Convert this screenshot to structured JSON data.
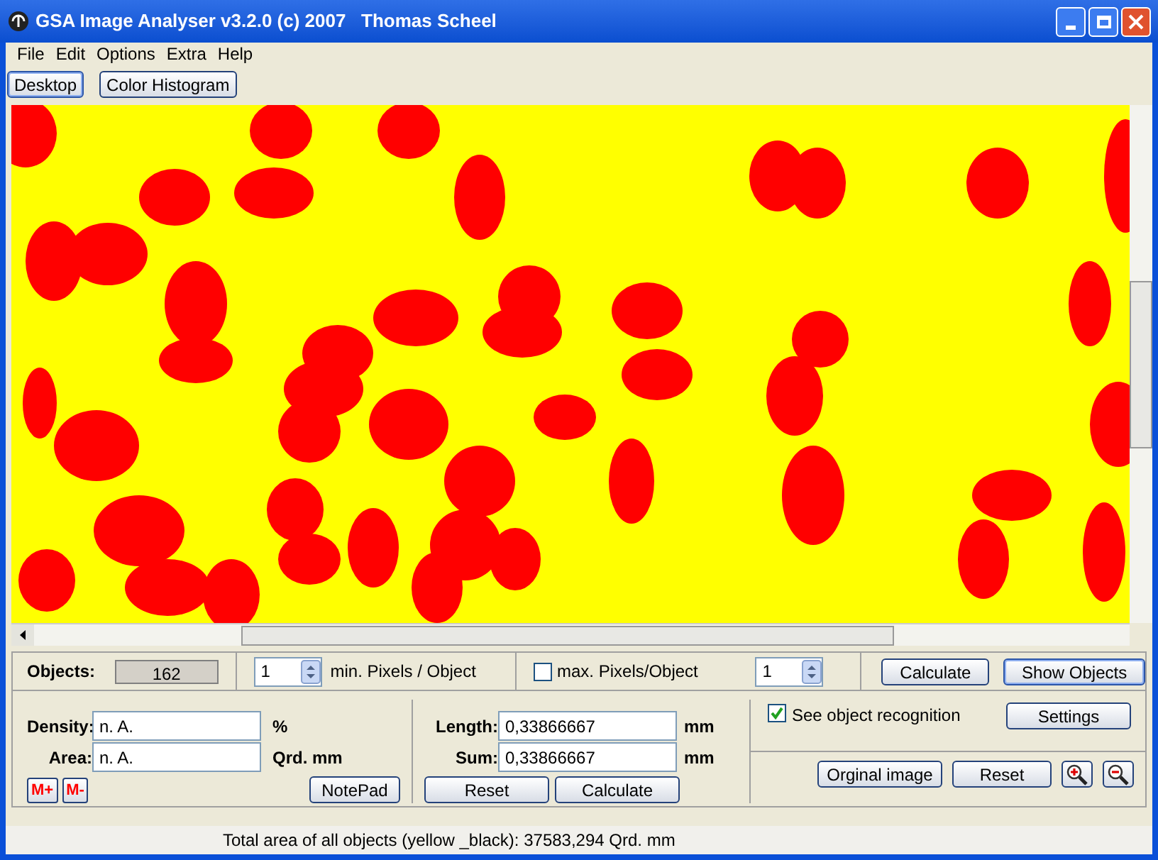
{
  "window": {
    "title": "GSA Image Analyser v3.2.0 (c) 2007   Thomas Scheel"
  },
  "menu": [
    "File",
    "Edit",
    "Options",
    "Extra",
    "Help"
  ],
  "toolbar": [
    {
      "label": "Desktop",
      "selected": true
    },
    {
      "label": "Color Histogram",
      "selected": false
    }
  ],
  "objects": {
    "label": "Objects:",
    "count": "162",
    "min_value": "1",
    "min_label": "min. Pixels / Object",
    "max_checked": false,
    "max_label": "max. Pixels/Object",
    "max_value": "1",
    "calculate": "Calculate",
    "show_objects": "Show Objects"
  },
  "density": {
    "label": "Density:",
    "value": "n. A.",
    "unit": "%"
  },
  "area": {
    "label": "Area:",
    "value": "n. A.",
    "unit": "Qrd. mm"
  },
  "memory": [
    "M+",
    "M-"
  ],
  "notepad": "NotePad",
  "length": {
    "label": "Length:",
    "value": "0,33866667",
    "unit": "mm"
  },
  "sum": {
    "label": "Sum:",
    "value": "0,33866667",
    "unit": "mm"
  },
  "measure_buttons": [
    "Reset",
    "Calculate"
  ],
  "recognition": {
    "label": "See object recognition",
    "checked": true
  },
  "settings": "Settings",
  "view_buttons": [
    "Orginal image",
    "Reset"
  ],
  "status_bar": "Total area of all objects (yellow _black): 37583,294 Qrd. mm"
}
